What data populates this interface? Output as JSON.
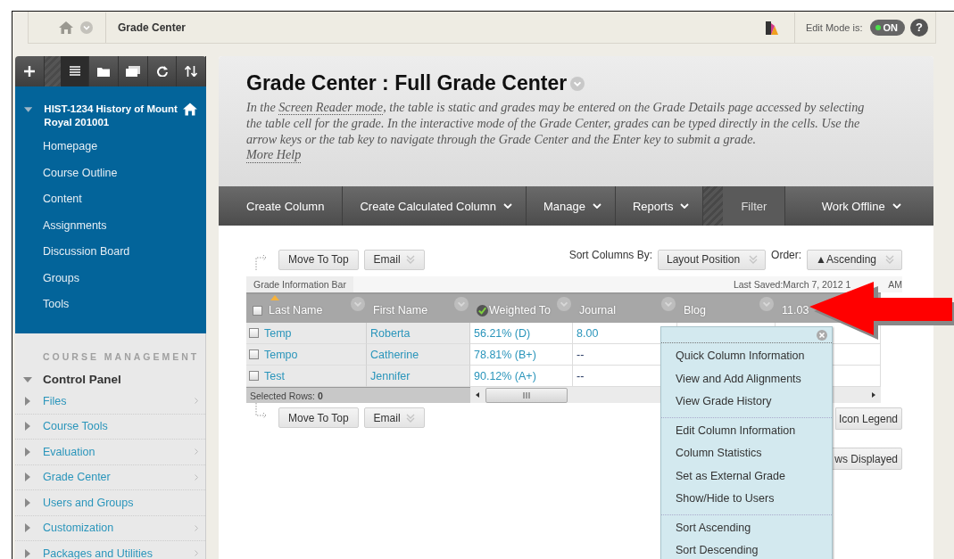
{
  "topbar": {
    "title": "Grade Center",
    "edit_mode_label": "Edit Mode is:",
    "edit_mode": {
      "label": "ON",
      "on": true
    },
    "help": "?"
  },
  "sidebar": {
    "tools": [
      {
        "kind": "add",
        "selected": false
      },
      {
        "kind": "list",
        "selected": true
      },
      {
        "kind": "folder",
        "selected": false
      },
      {
        "kind": "windows",
        "selected": false
      },
      {
        "kind": "refresh",
        "selected": false
      },
      {
        "kind": "sort",
        "selected": false
      }
    ],
    "course": {
      "title": "HIST-1234 History of Mount Royal 201001",
      "expanded": true,
      "items": [
        "Homepage",
        "Course Outline",
        "Content",
        "Assignments",
        "Discussion Board",
        "Groups",
        "Tools"
      ]
    },
    "management": {
      "heading": "COURSE MANAGEMENT",
      "panel": {
        "title": "Control Panel",
        "expanded": true,
        "items": [
          {
            "label": "Files",
            "submenu": true
          },
          {
            "label": "Course Tools",
            "submenu": false
          },
          {
            "label": "Evaluation",
            "submenu": true
          },
          {
            "label": "Grade Center",
            "submenu": true
          },
          {
            "label": "Users and Groups",
            "submenu": false
          },
          {
            "label": "Customization",
            "submenu": true
          },
          {
            "label": "Packages and Utilities",
            "submenu": true
          }
        ]
      }
    }
  },
  "page": {
    "title": "Grade Center : Full Grade Center",
    "description": {
      "before": "In the ",
      "link": "Screen Reader mode",
      "after": ", the table is static and grades may be entered on the Grade Details page accessed by selecting the table cell for the grade. In the interactive mode of the Grade Center, grades can be typed directly in the cells. Use the arrow keys or the tab key to navigate through the Grade Center and the Enter key to submit a grade."
    },
    "help_link": "More Help"
  },
  "action_bar": [
    {
      "label": "Create Column",
      "menu": false,
      "kind": "action"
    },
    {
      "label": "Create Calculated Column",
      "menu": true,
      "kind": "action"
    },
    {
      "label": "Manage",
      "menu": true,
      "kind": "action"
    },
    {
      "label": "Reports",
      "menu": true,
      "kind": "action"
    },
    {
      "label": "Filter",
      "menu": false,
      "kind": "filter"
    },
    {
      "label": "Work Offline",
      "menu": true,
      "kind": "action"
    }
  ],
  "toolbar_top": {
    "buttons": [
      {
        "label": "Move To Top",
        "menu": false
      },
      {
        "label": "Email",
        "menu": true
      }
    ],
    "sort_label": "Sort Columns By:",
    "sort_value": "Layout Position",
    "order_label": "Order:",
    "order_value": "▲Ascending"
  },
  "info_bar": {
    "tab": "Grade Information Bar",
    "last_saved": "Last Saved:March 7, 2012 1",
    "last_saved_tail": "AM"
  },
  "table": {
    "select_all": false,
    "columns": [
      {
        "label": "Last Name",
        "sorted": true,
        "kind": "text"
      },
      {
        "label": "First Name",
        "sorted": false,
        "kind": "text"
      },
      {
        "label": "Weighted To",
        "sorted": false,
        "kind": "weighted"
      },
      {
        "label": "Journal",
        "sorted": false,
        "kind": "text"
      },
      {
        "label": "Blog",
        "sorted": false,
        "kind": "text"
      },
      {
        "label": "11.03",
        "sorted": false,
        "kind": "text"
      }
    ],
    "rows": [
      {
        "checked": false,
        "cells": [
          "Temp",
          "Roberta",
          "56.21% (D)",
          "8.00"
        ]
      },
      {
        "checked": false,
        "cells": [
          "Tempo",
          "Catherine",
          "78.81% (B+)",
          "--"
        ]
      },
      {
        "checked": false,
        "cells": [
          "Test",
          "Jennifer",
          "90.12% (A+)",
          "--"
        ]
      }
    ],
    "selected_rows": "Selected Rows: **0**"
  },
  "toolbar_bottom": {
    "buttons": [
      {
        "label": "Move To Top",
        "menu": false
      },
      {
        "label": "Email",
        "menu": true
      }
    ],
    "right_buttons": [
      "Icon Legend",
      "ws Displayed"
    ]
  },
  "column_menu": {
    "groups": [
      [
        "Quick Column Information",
        "View and Add Alignments",
        "View Grade History"
      ],
      [
        "Edit Column Information",
        "Column Statistics",
        "Set as External Grade",
        "Show/Hide to Users"
      ],
      [
        "Sort Ascending",
        "Sort Descending"
      ]
    ]
  }
}
